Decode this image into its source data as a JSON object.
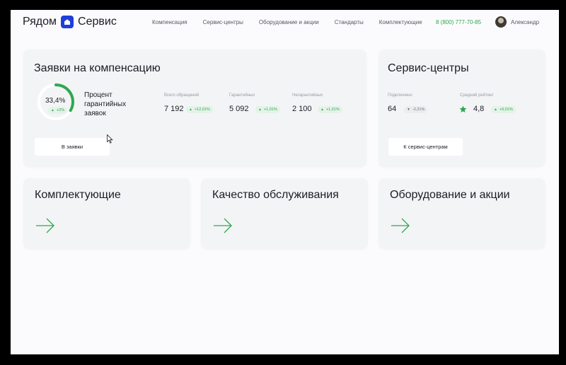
{
  "header": {
    "logo_left": "Рядом",
    "logo_right": "Сервис",
    "nav": [
      "Компенсация",
      "Сервис-центры",
      "Оборудование и акции",
      "Стандарты",
      "Комплектующие"
    ],
    "phone": "8 (800) 777-70-85",
    "user_name": "Александр"
  },
  "compensation": {
    "title": "Заявки на компенсацию",
    "gauge": {
      "percent": "33,4%",
      "fraction": 0.334,
      "delta": "+2%"
    },
    "gauge_label": [
      "Процент",
      "гарантийных",
      "заявок"
    ],
    "stats": [
      {
        "label": "Всего обращений",
        "value": "7 192",
        "delta": "+12,01%"
      },
      {
        "label": "Гарантийных",
        "value": "5 092",
        "delta": "+1,01%"
      },
      {
        "label": "Негарантийных",
        "value": "2 100",
        "delta": "+1,01%"
      }
    ],
    "button": "В заявки"
  },
  "service_centers": {
    "title": "Сервис-центры",
    "connected_label": "Подключено",
    "connected_value": "64",
    "connected_delta": "-2,21%",
    "rating_label": "Средний рейтинг",
    "rating_value": "4,8",
    "rating_delta": "+9,01%",
    "button": "К сервис-центрам"
  },
  "tiles": [
    {
      "title": "Комплектующие"
    },
    {
      "title": "Качество обслуживания"
    },
    {
      "title": "Оборудование и акции"
    }
  ],
  "colors": {
    "accent": "#2fa84f",
    "brand": "#1e3fd8",
    "card": "#f3f4f6"
  },
  "icons": [
    "house-icon",
    "star-icon",
    "arrow-right-icon",
    "cursor-icon"
  ]
}
